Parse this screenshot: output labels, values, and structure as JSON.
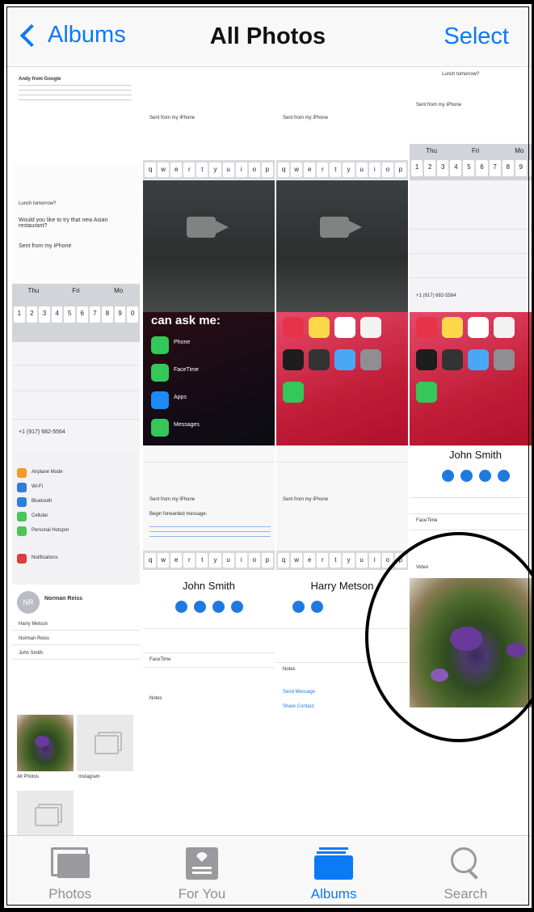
{
  "nav": {
    "back_label": "Albums",
    "title": "All Photos",
    "select_label": "Select"
  },
  "tabs": [
    {
      "label": "Photos",
      "icon": "photos-icon",
      "active": false
    },
    {
      "label": "For You",
      "icon": "for-you-icon",
      "active": false
    },
    {
      "label": "Albums",
      "icon": "albums-icon",
      "active": true
    },
    {
      "label": "Search",
      "icon": "search-icon",
      "active": false
    }
  ],
  "colors": {
    "accent": "#0a7af5",
    "inactive": "#8e8e93",
    "bar": "#f8f8f8"
  },
  "thumbs": {
    "email_sender": "Andy from Google",
    "sent_from": "Sent from my iPhone",
    "subject_lunch": "Lunch tomorrow?",
    "asian_restaurant": "Would you like to try that new Asian restaurant?",
    "keyboard_keys": [
      "q",
      "w",
      "e",
      "r",
      "t",
      "y",
      "u",
      "i",
      "o",
      "p"
    ],
    "number_keys": [
      "1",
      "2",
      "3",
      "4",
      "5",
      "6",
      "7",
      "8",
      "9",
      "0"
    ],
    "days": [
      "Thu",
      "Fri",
      "Mo"
    ],
    "siri_header": "can ask me:",
    "siri_items": [
      "Phone",
      "FaceTime",
      "Apps",
      "Messages"
    ],
    "contact_john": "John Smith",
    "contact_harry": "Harry Metson",
    "contact_norman": "Norman Reiss",
    "norman_initials": "NR",
    "people_list": [
      "Harry Metson",
      "Norman Reiss",
      "John Smith"
    ],
    "settings_items": [
      "Airplane Mode",
      "Wi-Fi",
      "Bluetooth",
      "Cellular",
      "Personal Hotspot",
      "Notifications"
    ],
    "facetime_label": "FaceTime",
    "notes_label": "Notes",
    "video_label": "Video",
    "phone_number": "+1 (917) 682-5564",
    "send_message": "Send Message",
    "share_contact": "Share Contact",
    "album_all": "All Photos",
    "album_instagram": "Instagram",
    "forwarded": "Begin forwarded message:"
  }
}
